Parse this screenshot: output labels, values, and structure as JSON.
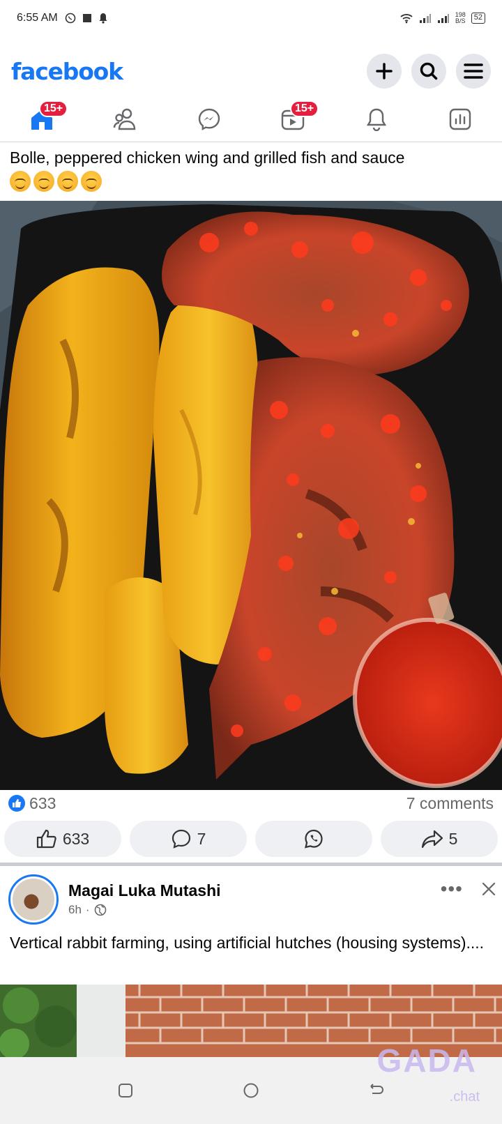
{
  "status_bar": {
    "time": "6:55 AM",
    "speed_value": "198",
    "speed_unit": "B/S",
    "battery": "52"
  },
  "header": {
    "logo_text": "facebook",
    "brand_color": "#1877f2",
    "buttons": [
      "plus-icon",
      "search-icon",
      "menu-icon"
    ]
  },
  "nav": {
    "tabs": [
      {
        "name": "home",
        "icon": "home-icon",
        "badge": "15+",
        "active": true
      },
      {
        "name": "friends",
        "icon": "friends-icon",
        "badge": ""
      },
      {
        "name": "messenger",
        "icon": "messenger-icon",
        "badge": ""
      },
      {
        "name": "watch",
        "icon": "video-icon",
        "badge": "15+"
      },
      {
        "name": "notifications",
        "icon": "bell-icon",
        "badge": ""
      },
      {
        "name": "dashboard",
        "icon": "dashboard-icon",
        "badge": ""
      }
    ]
  },
  "post1": {
    "text": "Bolle, peppered chicken wing and grilled fish and sauce",
    "emoji_count": 4,
    "reaction_count": "633",
    "comments_label": "7 comments",
    "actions": {
      "like": "633",
      "comment": "7",
      "whatsapp": "",
      "share": "5"
    }
  },
  "post2": {
    "author": "Magai Luka Mutashi",
    "time": "6h",
    "dot": "·",
    "text": "Vertical rabbit farming, using artificial hutches (housing systems)...."
  },
  "watermark": {
    "main": "GADA",
    "sub": ".chat"
  }
}
